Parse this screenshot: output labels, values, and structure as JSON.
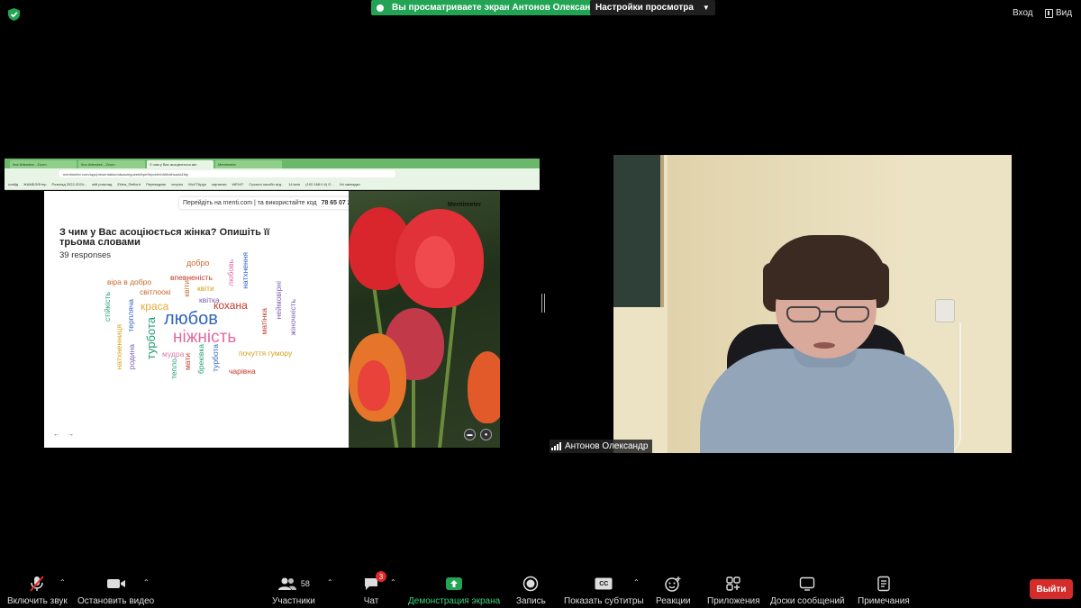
{
  "top": {
    "share_banner": "Вы просматриваете экран Антонов Олександр",
    "view_options": "Настройки просмотра",
    "enter_label": "Вход",
    "view_label": "Вид"
  },
  "browser": {
    "tabs": [
      "Ihor Attendee - Zoom",
      "Ihor Attendee - Zoom",
      "З чим у Вас асоціюється жін",
      "Mentimeter"
    ],
    "url": "mentimeter.com/app/presentation/alwaomgueeb8rpe9kpvehhhht5/alhsa4a1fdy",
    "bookmarks": [
      "слайд",
      "ЖАМБЛ/Фтпр",
      "Розклад 2022-2024...",
      "мій розклад",
      "Zbiea_Sieflord",
      "Переводчик",
      "спорно",
      "МоУТАрgo",
      "картинки",
      "WENIT",
      "Сучасні засоби атд..",
      "14.kem",
      "(192.168.0.4) G...",
      "Усі закладки"
    ]
  },
  "slide": {
    "code_prompt": "Перейдіть на menti.com | та використайте код",
    "code": "78 65 07 2",
    "logo": "Mentimeter",
    "question": "З чим у Вас асоціюється жінка? Опишіть її трьома словами",
    "responses": "39 responses",
    "nav_prev": "←",
    "nav_next": "→",
    "words": [
      {
        "text": "добро",
        "color": "#c86a2a",
        "size": 9
      },
      {
        "text": "віра в добро",
        "color": "#c86a2a",
        "size": 8.5
      },
      {
        "text": "впевненість",
        "color": "#c0392b",
        "size": 8.5
      },
      {
        "text": "квіти",
        "color": "#d4a017",
        "size": 8.5
      },
      {
        "text": "світлоокі",
        "color": "#c86a2a",
        "size": 8.5
      },
      {
        "text": "квітка",
        "color": "#7b61b5",
        "size": 8.5
      },
      {
        "text": "краса",
        "color": "#e8a838",
        "size": 12
      },
      {
        "text": "кохана",
        "color": "#c0392b",
        "size": 12
      },
      {
        "text": "любов",
        "color": "#2f64c4",
        "size": 20
      },
      {
        "text": "ніжність",
        "color": "#e06aa0",
        "size": 19
      },
      {
        "text": "мудра",
        "color": "#d57aaa",
        "size": 8.5
      },
      {
        "text": "почуття гумору",
        "color": "#d4a017",
        "size": 8.5
      },
      {
        "text": "чарівна",
        "color": "#c0392b",
        "size": 8.5
      },
      {
        "text": "любовь",
        "color": "#e06aa0",
        "size": 8.5
      },
      {
        "text": "натхнення",
        "color": "#2f64c4",
        "size": 8.5
      },
      {
        "text": "неймовірні",
        "color": "#7b61b5",
        "size": 8.5
      },
      {
        "text": "жіночність",
        "color": "#7b61b5",
        "size": 8.5
      },
      {
        "text": "стійкість",
        "color": "#1f9e6e",
        "size": 8.5
      },
      {
        "text": "натхненниця",
        "color": "#d4a017",
        "size": 8.5
      },
      {
        "text": "терплячa",
        "color": "#2f64c4",
        "size": 8.5
      },
      {
        "text": "турбота",
        "color": "#1f9e6e",
        "size": 13
      },
      {
        "text": "родина",
        "color": "#7b61b5",
        "size": 8.5
      },
      {
        "text": "квіти",
        "color": "#c86a2a",
        "size": 8.5
      },
      {
        "text": "матінка",
        "color": "#c0392b",
        "size": 8.5
      },
      {
        "text": "тепло",
        "color": "#1f9e6e",
        "size": 8.5
      },
      {
        "text": "мати",
        "color": "#c0392b",
        "size": 8.5
      },
      {
        "text": "бреківка",
        "color": "#1f9e6e",
        "size": 8.5
      },
      {
        "text": "турбота",
        "color": "#2f64c4",
        "size": 8.5
      }
    ]
  },
  "participant": {
    "name": "Антонов Олександр"
  },
  "toolbar": {
    "mute": "Включить звук",
    "video": "Остановить видео",
    "participants": "Участники",
    "participants_count": "58",
    "chat": "Чат",
    "chat_badge": "3",
    "share": "Демонстрация экрана",
    "record": "Запись",
    "captions": "Показать субтитры",
    "captions_icon": "CC",
    "reactions": "Реакции",
    "apps": "Приложения",
    "whiteboards": "Доски сообщений",
    "notes": "Примечания",
    "leave": "Выйти"
  },
  "colors": {
    "share_green": "#23a455",
    "leave_red": "#d42b2b",
    "badge_red": "#e02828",
    "share_label_green": "#3fd07a"
  },
  "icons": [
    "shield-icon",
    "view-icon",
    "mic-muted-icon",
    "video-camera-icon",
    "participants-icon",
    "chat-icon",
    "share-screen-icon",
    "record-icon",
    "captions-icon",
    "reactions-icon",
    "apps-icon",
    "whiteboard-icon",
    "notes-icon",
    "signal-icon"
  ]
}
